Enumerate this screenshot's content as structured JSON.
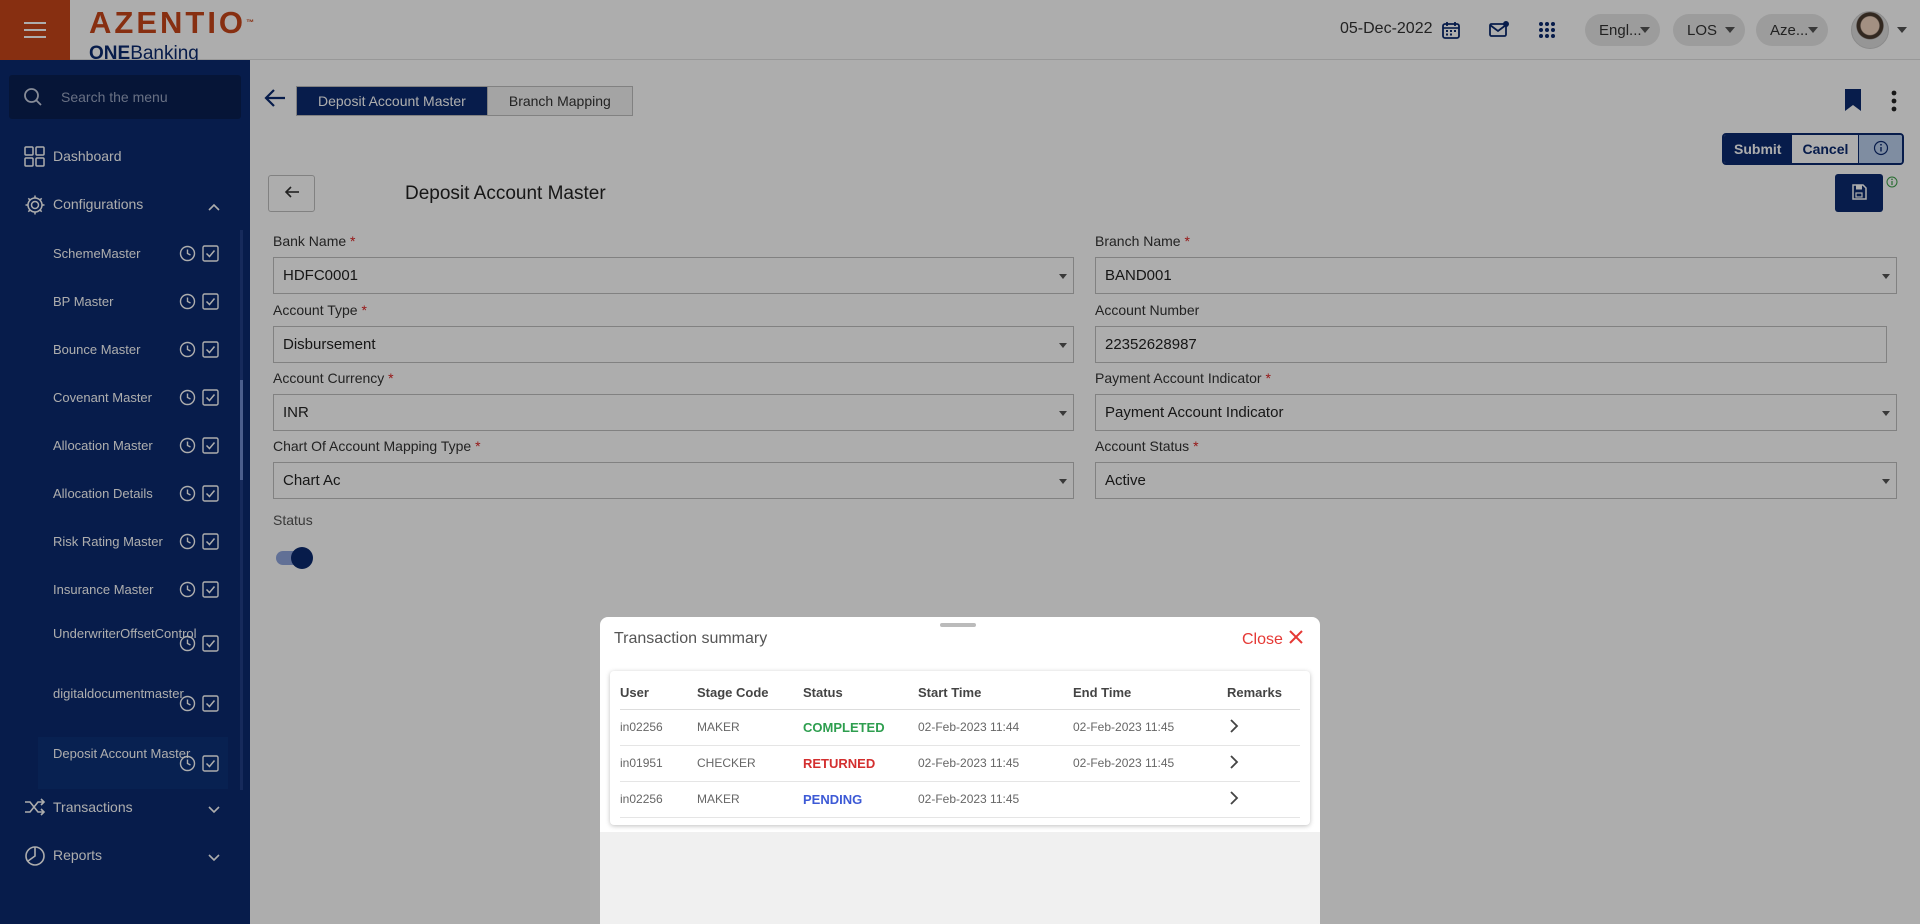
{
  "header": {
    "brand": "AZENTIO",
    "brand_tm": "™",
    "brand_sub_bold": "ONE",
    "brand_sub": "Banking",
    "date": "05-Dec-2022",
    "lang_pill": "Engl...",
    "module_pill": "LOS",
    "entity_pill": "Aze..."
  },
  "sidebar": {
    "search_placeholder": "Search the menu",
    "dashboard": "Dashboard",
    "configurations": "Configurations",
    "items": [
      {
        "label": "SchemeMaster"
      },
      {
        "label": "BP Master"
      },
      {
        "label": "Bounce Master"
      },
      {
        "label": "Covenant Master"
      },
      {
        "label": "Allocation Master"
      },
      {
        "label": "Allocation Details"
      },
      {
        "label": "Risk Rating Master"
      },
      {
        "label": "Insurance Master"
      },
      {
        "label": "UnderwriterOffsetControl"
      },
      {
        "label": "digitaldocumentmaster"
      },
      {
        "label": "Deposit Account Master"
      }
    ],
    "transactions": "Transactions",
    "reports": "Reports"
  },
  "tabs": [
    {
      "label": "Deposit Account Master",
      "active": true
    },
    {
      "label": "Branch Mapping",
      "active": false
    }
  ],
  "actions": {
    "submit": "Submit",
    "cancel": "Cancel"
  },
  "form": {
    "title": "Deposit Account Master",
    "bank_name": {
      "label": "Bank Name",
      "value": "HDFC0001"
    },
    "branch_name": {
      "label": "Branch Name",
      "value": "BAND001"
    },
    "account_type": {
      "label": "Account Type",
      "value": "Disbursement"
    },
    "account_number": {
      "label": "Account Number",
      "value": "22352628987"
    },
    "account_currency": {
      "label": "Account Currency",
      "value": "INR"
    },
    "payment_account_indicator": {
      "label": "Payment Account Indicator",
      "value": "Payment Account Indicator"
    },
    "coa_mapping_type": {
      "label": "Chart Of Account Mapping Type",
      "value": "Chart Ac"
    },
    "account_status": {
      "label": "Account Status",
      "value": "Active"
    },
    "required_mark": "*",
    "status_label": "Status",
    "status_on": true
  },
  "transaction_summary": {
    "title": "Transaction summary",
    "close": "Close",
    "columns": [
      "User",
      "Stage Code",
      "Status",
      "Start Time",
      "End Time",
      "Remarks"
    ],
    "rows": [
      {
        "user": "in02256",
        "stage": "MAKER",
        "status": "COMPLETED",
        "start": "02-Feb-2023 11:44",
        "end": "02-Feb-2023 11:45"
      },
      {
        "user": "in01951",
        "stage": "CHECKER",
        "status": "RETURNED",
        "start": "02-Feb-2023 11:45",
        "end": "02-Feb-2023 11:45"
      },
      {
        "user": "in02256",
        "stage": "MAKER",
        "status": "PENDING",
        "start": "02-Feb-2023 11:45",
        "end": ""
      }
    ]
  },
  "colors": {
    "brand_orange": "#c8461a",
    "navy": "#0b2a6f",
    "completed": "#2e9e4f",
    "returned": "#d32f2f",
    "pending": "#3d5ad6"
  }
}
